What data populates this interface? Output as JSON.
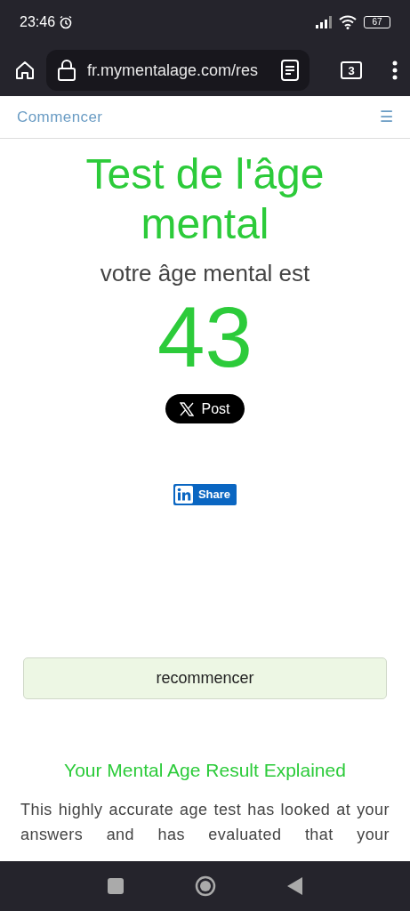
{
  "status_bar": {
    "time": "23:46",
    "battery": "67"
  },
  "browser": {
    "url": "fr.mymentalage.com/res",
    "tab_count": "3"
  },
  "site_nav": {
    "link": "Commencer",
    "menu_glyph": "☰"
  },
  "result": {
    "title": "Test de l'âge mental",
    "subtitle": "votre âge mental est",
    "age": "43"
  },
  "share": {
    "x_label": "Post",
    "linkedin_label": "Share"
  },
  "restart_button": "recommencer",
  "explanation": {
    "heading": "Your Mental Age Result Explained",
    "text": "This highly accurate age test has looked at your answers and has evaluated that your"
  }
}
